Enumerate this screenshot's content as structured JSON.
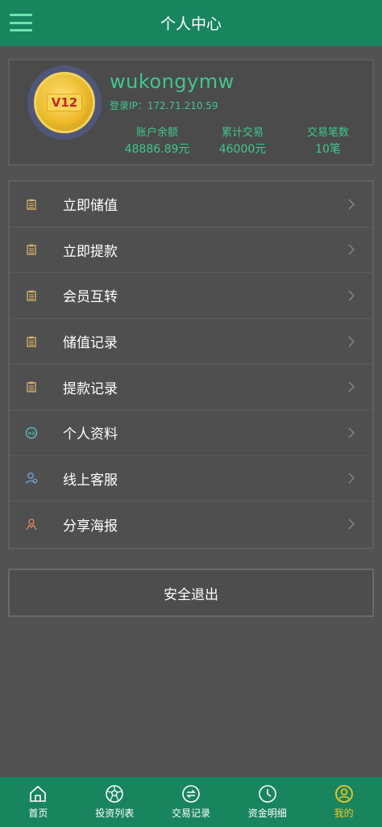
{
  "header": {
    "title": "个人中心",
    "menu_icon": "hamburger-menu-icon"
  },
  "profile": {
    "vip_badge": "V12",
    "username": "wukongymw",
    "login_ip": "登录IP：172.71.210.59",
    "stats": [
      {
        "label": "账户余额",
        "value": "48886.89元"
      },
      {
        "label": "累计交易",
        "value": "46000元"
      },
      {
        "label": "交易笔数",
        "value": "10笔"
      }
    ]
  },
  "menu": {
    "items": [
      {
        "label": "立即储值",
        "icon": "clipboard-icon"
      },
      {
        "label": "立即提款",
        "icon": "clipboard-icon"
      },
      {
        "label": "会员互转",
        "icon": "clipboard-icon"
      },
      {
        "label": "储值记录",
        "icon": "clipboard-icon"
      },
      {
        "label": "提款记录",
        "icon": "clipboard-icon"
      },
      {
        "label": "个人资料",
        "icon": "id-card-icon"
      },
      {
        "label": "线上客服",
        "icon": "customer-service-icon"
      },
      {
        "label": "分享海报",
        "icon": "share-user-icon"
      }
    ]
  },
  "logout_label": "安全退出",
  "tabbar": {
    "tabs": [
      {
        "label": "首页",
        "icon": "home-icon"
      },
      {
        "label": "投资列表",
        "icon": "football-icon"
      },
      {
        "label": "交易记录",
        "icon": "exchange-icon"
      },
      {
        "label": "资金明细",
        "icon": "clock-icon"
      },
      {
        "label": "我的",
        "icon": "user-circle-icon",
        "active": true
      }
    ]
  },
  "colors": {
    "primary": "#19855f",
    "accent_text": "#3fc78f",
    "active_tab": "#f3c628",
    "background": "#525252"
  }
}
